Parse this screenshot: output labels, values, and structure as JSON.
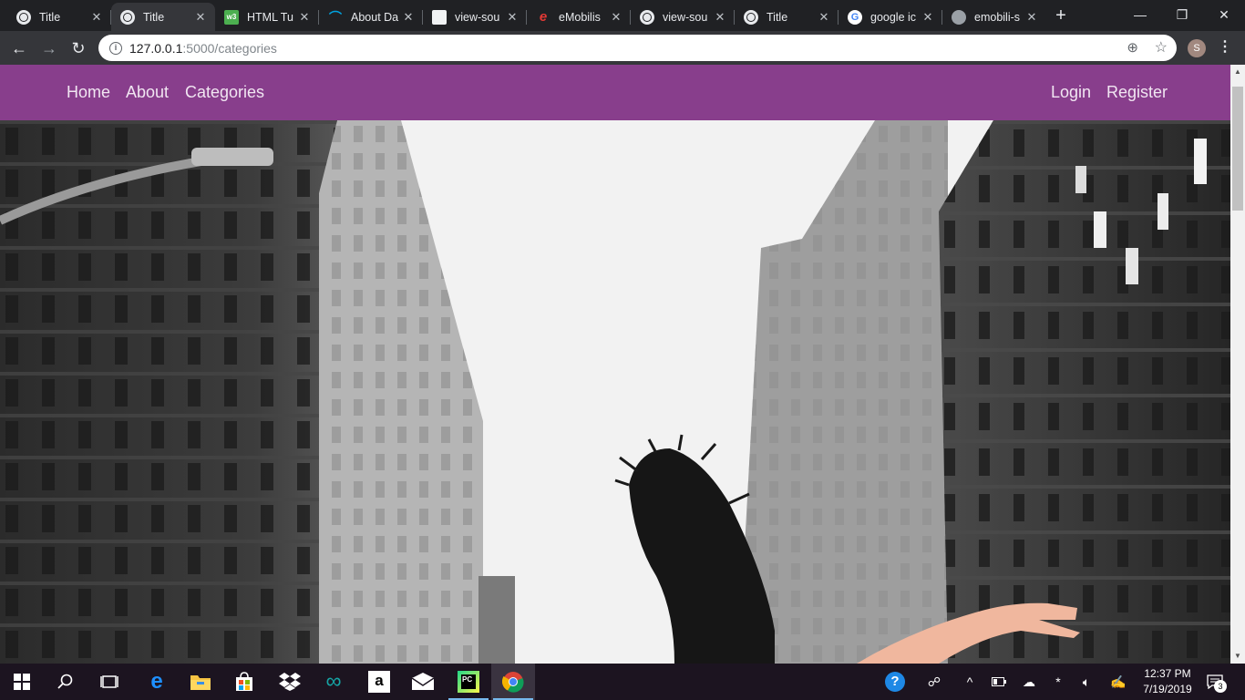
{
  "browser": {
    "tabs": [
      {
        "title": "Title",
        "favicon": "globe-icon",
        "active": false
      },
      {
        "title": "Title",
        "favicon": "globe-icon",
        "active": true
      },
      {
        "title": "HTML Tu",
        "favicon": "w3schools-icon",
        "active": false
      },
      {
        "title": "About Da",
        "favicon": "datacamp-icon",
        "active": false
      },
      {
        "title": "view-sou",
        "favicon": "blank-page-icon",
        "active": false
      },
      {
        "title": "eMobilis",
        "favicon": "emobilis-icon",
        "active": false
      },
      {
        "title": "view-sou",
        "favicon": "globe-icon",
        "active": false
      },
      {
        "title": "Title",
        "favicon": "globe-icon",
        "active": false
      },
      {
        "title": "google ic",
        "favicon": "google-icon",
        "active": false
      },
      {
        "title": "emobili-s",
        "favicon": "globe-icon",
        "active": false
      }
    ],
    "new_tab_glyph": "+",
    "address": {
      "host": "127.0.0.1",
      "rest": ":5000/categories"
    },
    "profile_initial": "S"
  },
  "site": {
    "nav_left": [
      "Home",
      "About",
      "Categories"
    ],
    "nav_right": [
      "Login",
      "Register"
    ],
    "nav_color": "#883e8c",
    "hero_image": "black-and-white street photo between tall buildings with a woman's hair flipping and a raised arm"
  },
  "taskbar": {
    "pinned": [
      "start-icon",
      "search-icon",
      "task-view-icon",
      "edge-icon",
      "file-explorer-icon",
      "store-icon",
      "dropbox-icon",
      "arduino-icon",
      "amazon-icon",
      "mail-icon",
      "pycharm-icon",
      "chrome-icon"
    ],
    "clock_time": "12:37 PM",
    "clock_date": "7/19/2019",
    "notification_count": "3"
  }
}
